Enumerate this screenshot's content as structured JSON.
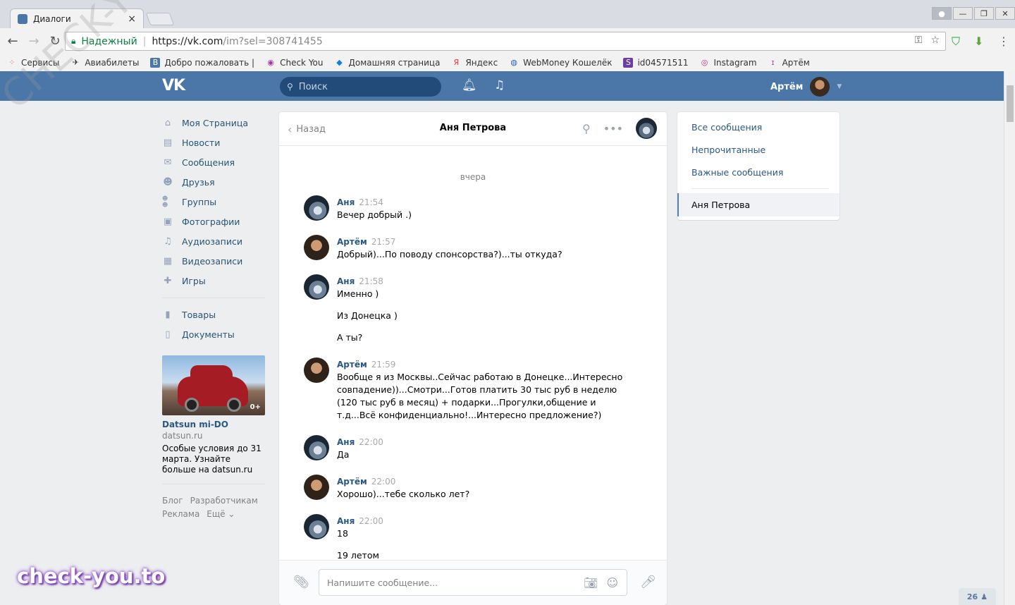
{
  "browser": {
    "tab_title": "Диалоги",
    "tab_close": "×",
    "secure_label": "Надежный",
    "url_host": "https://vk.com",
    "url_path": "/im?sel=308741455",
    "bookmarks": [
      {
        "icon": "apps-icon",
        "label": "Сервисы"
      },
      {
        "icon": "plane-icon",
        "label": "Авиабилеты"
      },
      {
        "icon": "vk-icon",
        "label": "Добро пожаловать |"
      },
      {
        "icon": "checkyou-icon",
        "label": "Check You"
      },
      {
        "icon": "dropbox-icon",
        "label": "Домашняя страница"
      },
      {
        "icon": "yandex-icon",
        "label": "Яндекс"
      },
      {
        "icon": "webmoney-icon",
        "label": "WebMoney Кошелёк"
      },
      {
        "icon": "skype-icon",
        "label": "id04571511"
      },
      {
        "icon": "instagram-icon",
        "label": "Instagram"
      },
      {
        "icon": "person-icon",
        "label": "Артём"
      }
    ]
  },
  "header": {
    "logo": "VK",
    "search_placeholder": "Поиск",
    "user_name": "Артём"
  },
  "left_menu": {
    "items": [
      {
        "icon": "home-icon",
        "label": "Моя Страница"
      },
      {
        "icon": "news-icon",
        "label": "Новости"
      },
      {
        "icon": "messages-icon",
        "label": "Сообщения"
      },
      {
        "icon": "friends-icon",
        "label": "Друзья"
      },
      {
        "icon": "groups-icon",
        "label": "Группы"
      },
      {
        "icon": "camera-icon",
        "label": "Фотографии"
      },
      {
        "icon": "music-icon",
        "label": "Аудиозаписи"
      },
      {
        "icon": "video-icon",
        "label": "Видеозаписи"
      },
      {
        "icon": "gamepad-icon",
        "label": "Игры"
      }
    ],
    "items2": [
      {
        "icon": "bag-icon",
        "label": "Товары"
      },
      {
        "icon": "document-icon",
        "label": "Документы"
      }
    ],
    "ad": {
      "badge": "0+",
      "title": "Datsun mi-DO",
      "domain": "datsun.ru",
      "text": "Особые условия до 31 марта. Узнайте больше на datsun.ru"
    },
    "footer": {
      "blog": "Блог",
      "developers": "Разработчикам",
      "ads": "Реклама",
      "more": "Ещё ⌄"
    }
  },
  "chat": {
    "back_label": "Назад",
    "title": "Аня Петрова",
    "day_label": "вчера",
    "messages": [
      {
        "author": "Аня",
        "time": "21:54",
        "text": "Вечер добрый .)"
      },
      {
        "author": "Артём",
        "time": "21:57",
        "text": "Добрый)...По поводу спонсорства?)...ты откуда?"
      },
      {
        "author": "Аня",
        "time": "21:58",
        "text": "Именно )",
        "extra1": "Из Донецка )",
        "extra2": "А ты?"
      },
      {
        "author": "Артём",
        "time": "21:59",
        "text": "Вообще я из Москвы..Сейчас работаю в Донецке...Интересно совпадение))...Смотри...Готов платить 30 тыс руб в неделю (120 тыс руб в месяц) + подарки...Прогулки,общение и т.д...Всё конфиденциально!...Интересно предложение?)"
      },
      {
        "author": "Аня",
        "time": "22:00",
        "text": "Да"
      },
      {
        "author": "Артём",
        "time": "22:00",
        "text": "Хорошо)...тебе сколько лет?"
      },
      {
        "author": "Аня",
        "time": "22:00",
        "text": "18",
        "extra1": "19 летом"
      }
    ],
    "input_placeholder": "Напишите сообщение..."
  },
  "filters": {
    "all": "Все сообщения",
    "unread": "Непрочитанные",
    "important": "Важные сообщения",
    "active_dialog": "Аня Петрова"
  },
  "counter": "26",
  "watermarks": {
    "bottom": "check-you.to",
    "diagonal": "CHECK-YOU.ME"
  },
  "colors": {
    "vk_blue": "#4a76a8",
    "link": "#2a5885",
    "secure_green": "#0b8043"
  }
}
